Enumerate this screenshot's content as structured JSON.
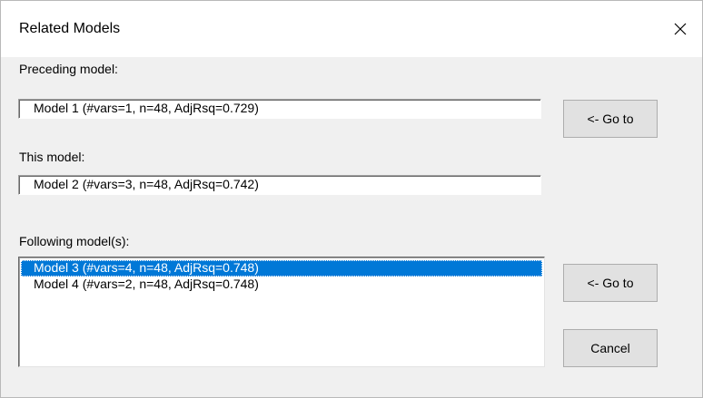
{
  "window": {
    "title": "Related Models",
    "close_icon": "close-icon"
  },
  "preceding": {
    "label": "Preceding model:",
    "value": "Model 1 (#vars=1, n=48, AdjRsq=0.729)",
    "goto_label": "<- Go to"
  },
  "current": {
    "label": "This model:",
    "value": "Model 2 (#vars=3, n=48, AdjRsq=0.742)"
  },
  "following": {
    "label": "Following model(s):",
    "items": [
      "Model 3 (#vars=4, n=48, AdjRsq=0.748)",
      "Model 4 (#vars=2, n=48, AdjRsq=0.748)"
    ],
    "selected_index": 0,
    "goto_label": "<- Go to"
  },
  "actions": {
    "cancel_label": "Cancel"
  },
  "colors": {
    "selection": "#0078d7",
    "dialog_bg": "#f0f0f0"
  }
}
